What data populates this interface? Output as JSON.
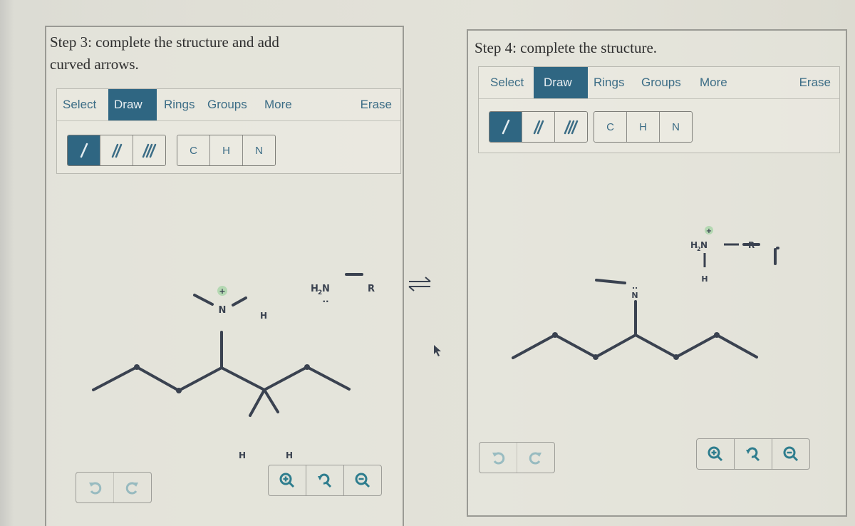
{
  "step3": {
    "title_line1": "Step 3: complete the structure and add",
    "title_line2": "curved arrows.",
    "tabs": [
      {
        "label": "Select",
        "active": false
      },
      {
        "label": "Draw",
        "active": true
      },
      {
        "label": "Rings",
        "active": false
      },
      {
        "label": "Groups",
        "active": false
      },
      {
        "label": "More",
        "active": false
      }
    ],
    "erase_label": "Erase",
    "bond_buttons": [
      {
        "name": "single-bond",
        "active": true
      },
      {
        "name": "double-bond",
        "active": false
      },
      {
        "name": "triple-bond",
        "active": false
      }
    ],
    "atom_buttons": [
      "C",
      "H",
      "N"
    ],
    "molecule": {
      "atoms": {
        "N": "N",
        "charge": "+",
        "H_top": "H",
        "H_left": "H",
        "H_right": "H"
      },
      "reagent": {
        "left": "H2N",
        "left_main": "H",
        "left_sub": "2",
        "left_tail": "N",
        "right": "R",
        "lone_pair": ".."
      }
    },
    "undo_icon": "undo-icon",
    "redo_icon": "redo-icon",
    "zoom_icons": [
      "zoom-in-icon",
      "zoom-reset-icon",
      "zoom-out-icon"
    ]
  },
  "equilibrium_arrow": "equilibrium-arrows-icon",
  "step4": {
    "title": "Step 4: complete the structure.",
    "tabs": [
      {
        "label": "Select",
        "active": false
      },
      {
        "label": "Draw",
        "active": true
      },
      {
        "label": "Rings",
        "active": false
      },
      {
        "label": "Groups",
        "active": false
      },
      {
        "label": "More",
        "active": false
      }
    ],
    "erase_label": "Erase",
    "bond_buttons": [
      {
        "name": "single-bond",
        "active": true
      },
      {
        "name": "double-bond",
        "active": false
      },
      {
        "name": "triple-bond",
        "active": false
      }
    ],
    "atom_buttons": [
      "C",
      "H",
      "N"
    ],
    "molecule": {
      "atoms": {
        "N": "N",
        "lone_pair": ".."
      },
      "product": {
        "left_main": "H",
        "left_sub": "2",
        "left_tail": "N",
        "charge": "+",
        "right": "R",
        "H_bottom": "H"
      }
    },
    "undo_icon": "undo-icon",
    "redo_icon": "redo-icon",
    "zoom_icons": [
      "zoom-in-icon",
      "zoom-reset-icon",
      "zoom-out-icon"
    ]
  }
}
